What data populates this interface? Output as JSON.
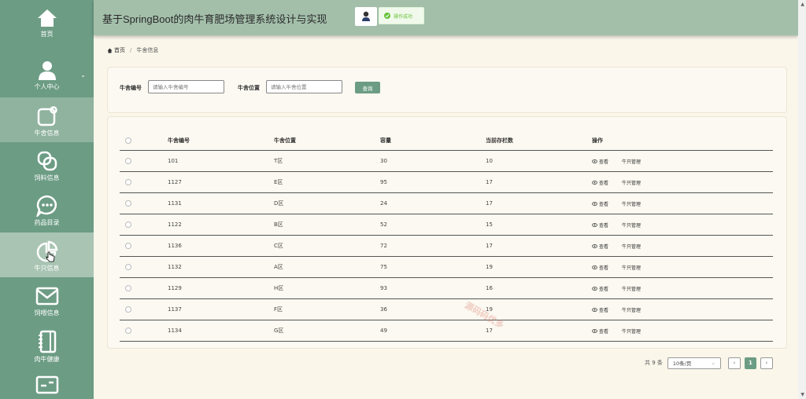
{
  "header": {
    "title": "基于SpringBoot的肉牛育肥场管理系统设计与实现"
  },
  "toast": {
    "text": "操作成功"
  },
  "sidebar": {
    "items": [
      {
        "label": "首页",
        "icon": "home-icon"
      },
      {
        "label": "个人中心",
        "icon": "user-icon"
      },
      {
        "label": "牛舍信息",
        "icon": "edit-icon"
      },
      {
        "label": "饲料信息",
        "icon": "link-icon"
      },
      {
        "label": "药品目录",
        "icon": "chat-icon"
      },
      {
        "label": "牛只信息",
        "icon": "pie-icon"
      },
      {
        "label": "饲喂信息",
        "icon": "mail-icon"
      },
      {
        "label": "肉牛健康",
        "icon": "notebook-icon"
      },
      {
        "label": "",
        "icon": "card-icon"
      }
    ]
  },
  "breadcrumb": {
    "home": "首页",
    "current": "牛舍信息"
  },
  "search": {
    "code_label": "牛舍编号",
    "code_placeholder": "请输入牛舍编号",
    "loc_label": "牛舍位置",
    "loc_placeholder": "请输入牛舍位置",
    "button": "查询"
  },
  "table": {
    "headers": [
      "牛舍编号",
      "牛舍位置",
      "容量",
      "当前存栏数",
      "操作"
    ],
    "view_label": "查看",
    "manage_label": "牛只管理",
    "rows": [
      {
        "code": "101",
        "loc": "T区",
        "cap": "30",
        "cur": "10"
      },
      {
        "code": "1127",
        "loc": "E区",
        "cap": "95",
        "cur": "17"
      },
      {
        "code": "1131",
        "loc": "D区",
        "cap": "24",
        "cur": "17"
      },
      {
        "code": "1122",
        "loc": "B区",
        "cap": "52",
        "cur": "15"
      },
      {
        "code": "1136",
        "loc": "C区",
        "cap": "72",
        "cur": "17"
      },
      {
        "code": "1132",
        "loc": "A区",
        "cap": "75",
        "cur": "19"
      },
      {
        "code": "1129",
        "loc": "H区",
        "cap": "93",
        "cur": "16"
      },
      {
        "code": "1137",
        "loc": "F区",
        "cap": "36",
        "cur": "19"
      },
      {
        "code": "1134",
        "loc": "G区",
        "cap": "49",
        "cur": "17"
      }
    ]
  },
  "pagination": {
    "total": "共 9 条",
    "page_size": "10条/页",
    "current": "1",
    "prev": "‹",
    "next": "›"
  },
  "watermark": "源码码优多",
  "colors": {
    "primary": "#6c9c84",
    "header": "#a3bfaa",
    "background": "#faf6ea"
  }
}
